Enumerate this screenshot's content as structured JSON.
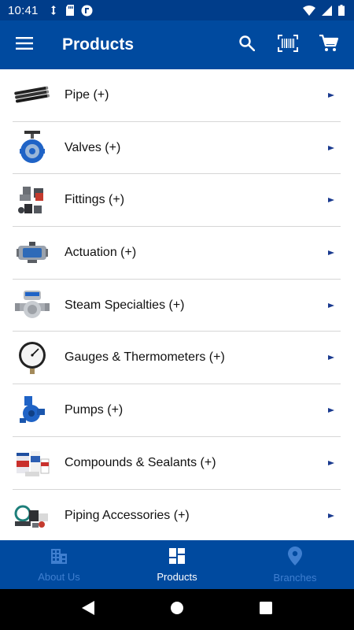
{
  "status_bar": {
    "time": "10:41",
    "icons": [
      "sync-icon",
      "sd-card-icon",
      "app-notification-icon",
      "wifi-icon",
      "cellular-icon",
      "battery-icon"
    ]
  },
  "app_bar": {
    "title": "Products",
    "actions": [
      "search-icon",
      "barcode-scanner-icon",
      "cart-icon"
    ],
    "color": "#004a9f"
  },
  "products": [
    {
      "label": "Pipe (+)",
      "icon": "pipe-thumbnail"
    },
    {
      "label": "Valves (+)",
      "icon": "valve-thumbnail"
    },
    {
      "label": "Fittings (+)",
      "icon": "fittings-thumbnail"
    },
    {
      "label": "Actuation (+)",
      "icon": "actuator-thumbnail"
    },
    {
      "label": "Steam Specialties (+)",
      "icon": "steam-trap-thumbnail"
    },
    {
      "label": "Gauges & Thermometers (+)",
      "icon": "gauge-thumbnail"
    },
    {
      "label": "Pumps (+)",
      "icon": "pump-thumbnail"
    },
    {
      "label": "Compounds & Sealants (+)",
      "icon": "sealants-thumbnail"
    },
    {
      "label": "Piping Accessories (+)",
      "icon": "accessories-thumbnail"
    }
  ],
  "bottom_nav": {
    "tabs": [
      {
        "label": "About Us",
        "icon": "building-icon",
        "active": false
      },
      {
        "label": "Products",
        "icon": "grid-icon",
        "active": true
      },
      {
        "label": "Branches",
        "icon": "location-pin-icon",
        "active": false
      }
    ]
  },
  "colors": {
    "primary": "#004a9f",
    "status_bar": "#003d8a",
    "inactive_tab": "#3f7fd0",
    "arrow": "#1a3a8f"
  }
}
